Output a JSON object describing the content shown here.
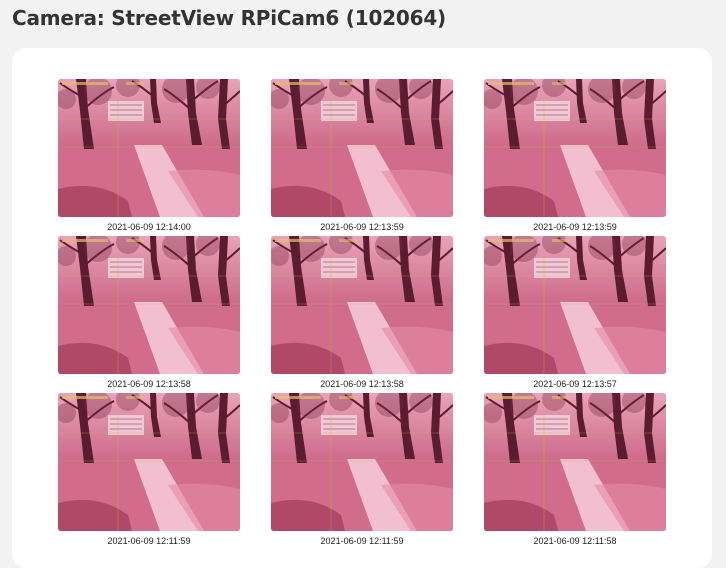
{
  "header": {
    "title": "Camera: StreetView RPiCam6 (102064)"
  },
  "colors": {
    "background": "#f2f2f2",
    "panel": "#ffffff",
    "title": "#333333",
    "photo_tint": "#c65a7b"
  },
  "snapshots": [
    {
      "timestamp": "2021-06-09 12:14:00"
    },
    {
      "timestamp": "2021-06-09 12:13:59"
    },
    {
      "timestamp": "2021-06-09 12:13:59"
    },
    {
      "timestamp": "2021-06-09 12:13:58"
    },
    {
      "timestamp": "2021-06-09 12:13:58"
    },
    {
      "timestamp": "2021-06-09 12:13:57"
    },
    {
      "timestamp": "2021-06-09 12:11:59"
    },
    {
      "timestamp": "2021-06-09 12:11:59"
    },
    {
      "timestamp": "2021-06-09 12:11:58"
    }
  ]
}
